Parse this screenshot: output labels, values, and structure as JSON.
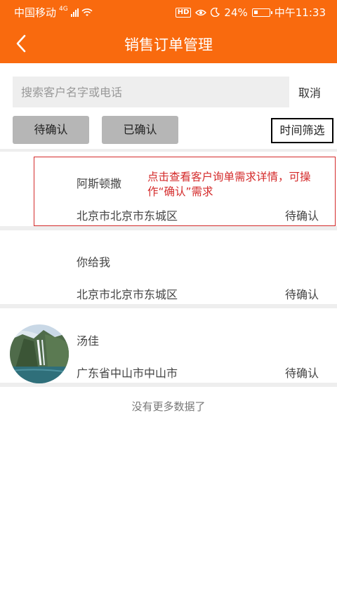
{
  "status_bar": {
    "carrier": "中国移动",
    "network": "4G",
    "hd": "HD",
    "battery": "24%",
    "battery_level": 0.24,
    "time": "中午11:33"
  },
  "nav": {
    "title": "销售订单管理"
  },
  "search": {
    "placeholder": "搜索客户名字或电话",
    "value": "",
    "cancel_label": "取消"
  },
  "filters": {
    "pending_label": "待确认",
    "confirmed_label": "已确认",
    "time_label": "时间筛选"
  },
  "orders": [
    {
      "name": "阿斯顿撒",
      "address": "北京市北京市东城区",
      "status": "待确认",
      "has_avatar": false
    },
    {
      "name": "你给我",
      "address": "北京市北京市东城区",
      "status": "待确认",
      "has_avatar": true
    },
    {
      "name": "汤佳",
      "address": "广东省中山市中山市",
      "status": "待确认",
      "has_avatar": true
    }
  ],
  "empty_text": "没有更多数据了",
  "annotation": {
    "text": "点击查看客户询单需求详情，可操作“确认”需求",
    "color": "#d42b2b"
  },
  "colors": {
    "brand": "#f96a0e",
    "filter_bg": "#b6b6b6",
    "separator": "#eeeeee"
  }
}
